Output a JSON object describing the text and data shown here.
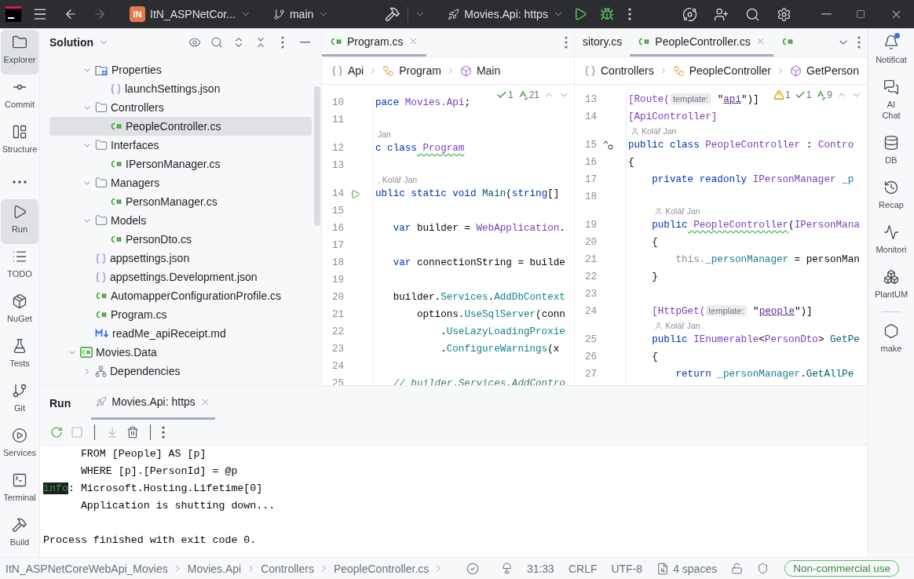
{
  "title_bar": {
    "back": {
      "disabled": false
    },
    "forward": {
      "disabled": true
    },
    "project": {
      "badge": "IN",
      "label": "ItN_ASPNetCor..."
    },
    "branch": "main",
    "run_config": "Movies.Api: https"
  },
  "left_toolbar": [
    {
      "label": "Explorer",
      "selected": true
    },
    {
      "label": "Commit",
      "selected": false
    },
    {
      "label": "Structure",
      "selected": false
    },
    {
      "selected": false
    },
    {
      "label": "Run",
      "selected": true
    },
    {
      "label": "TODO",
      "selected": false
    },
    {
      "label": "NuGet",
      "selected": false
    },
    {
      "label": "Tests",
      "selected": false
    },
    {
      "label": "Git",
      "selected": false
    },
    {
      "label": "Services",
      "selected": false
    },
    {
      "label": "Terminal",
      "selected": false
    },
    {
      "label": "Build",
      "selected": false
    }
  ],
  "project_panel": {
    "title": "Solution",
    "tree": [
      {
        "children": [
          {
            "label": "Properties",
            "kind": "properties",
            "expanded": true,
            "selected": false,
            "children": [
              {
                "label": "launchSettings.json",
                "kind": "json",
                "selected": false
              }
            ]
          },
          {
            "label": "Controllers",
            "kind": "folder",
            "expanded": true,
            "selected": false,
            "children": [
              {
                "label": "PeopleController.cs",
                "kind": "csharp",
                "selected": true
              }
            ]
          },
          {
            "label": "Interfaces",
            "kind": "folder",
            "expanded": true,
            "selected": false,
            "children": [
              {
                "label": "IPersonManager.cs",
                "kind": "csharp",
                "selected": false
              }
            ]
          },
          {
            "label": "Managers",
            "kind": "folder",
            "expanded": true,
            "selected": false,
            "children": [
              {
                "label": "PersonManager.cs",
                "kind": "csharp",
                "selected": false
              }
            ]
          },
          {
            "label": "Models",
            "kind": "folder",
            "expanded": true,
            "selected": false,
            "children": [
              {
                "label": "PersonDto.cs",
                "kind": "csharp",
                "selected": false
              }
            ]
          },
          {
            "label": "appsettings.json",
            "kind": "json",
            "selected": false
          },
          {
            "label": "appsettings.Development.json",
            "kind": "json",
            "selected": false
          },
          {
            "label": "AutomapperConfigurationProfile.cs",
            "kind": "csharp",
            "selected": false
          },
          {
            "label": "Program.cs",
            "kind": "csharp",
            "selected": false
          },
          {
            "label": "readMe_apiReceipt.md",
            "kind": "markdown",
            "selected": false
          }
        ]
      },
      {
        "label": "Movies.Data",
        "kind": "project",
        "expanded": true,
        "selected": false,
        "children": [
          {
            "label": "Dependencies",
            "kind": "dependencies",
            "expanded": false,
            "selected": false
          }
        ]
      }
    ]
  },
  "editors": [
    {
      "tabs": [
        {
          "label": "Program.cs",
          "kind": "csharp",
          "selected": true
        }
      ],
      "breadcrumb": [
        {
          "kind": "namespace",
          "label": "Api"
        },
        {
          "kind": "class",
          "label": "Program"
        },
        {
          "kind": "method",
          "label": "Main"
        }
      ],
      "inspections": [
        {
          "kind": "ok",
          "count": "1"
        },
        {
          "kind": "typo",
          "count": "21"
        }
      ],
      "lines": [
        {
          "kind": "code",
          "number": "10",
          "segments": [
            {
              "kind": "keyword",
              "text": "pace"
            },
            {
              "kind": "type",
              "text": " Movies.Api"
            },
            {
              "kind": "plain",
              "text": ";"
            }
          ]
        },
        {
          "kind": "code",
          "number": "11"
        },
        {
          "kind": "author",
          "text": "Jan",
          "avatar": false
        },
        {
          "kind": "code",
          "number": "12",
          "segments": [
            {
              "kind": "keyword",
              "text": "c class"
            },
            {
              "kind": "type-typo",
              "text": " Program"
            }
          ]
        },
        {
          "kind": "code",
          "number": "13"
        },
        {
          "kind": "author",
          "text": ", Kolář Jan",
          "avatar": false
        },
        {
          "kind": "code",
          "number": "14",
          "gutter": {
            "kind": "run"
          },
          "segments": [
            {
              "kind": "keyword",
              "text": "ublic static void"
            },
            {
              "kind": "method",
              "text": " Main"
            },
            {
              "kind": "plain",
              "text": "("
            },
            {
              "kind": "keyword",
              "text": "string"
            },
            {
              "kind": "plain",
              "text": "[]"
            }
          ]
        },
        {
          "kind": "code",
          "number": "15"
        },
        {
          "kind": "code",
          "number": "16",
          "segments": [
            {
              "kind": "keyword",
              "text": "   var"
            },
            {
              "kind": "plain",
              "text": " builder = "
            },
            {
              "kind": "type",
              "text": "WebApplication"
            },
            {
              "kind": "plain",
              "text": "."
            }
          ]
        },
        {
          "kind": "code",
          "number": "17"
        },
        {
          "kind": "code",
          "number": "18",
          "segments": [
            {
              "kind": "keyword",
              "text": "   var"
            },
            {
              "kind": "plain",
              "text": " connectionString = builde"
            }
          ]
        },
        {
          "kind": "code",
          "number": "19"
        },
        {
          "kind": "code",
          "number": "20",
          "segments": [
            {
              "kind": "plain",
              "text": "   builder."
            },
            {
              "kind": "member",
              "text": "Services"
            },
            {
              "kind": "plain",
              "text": "."
            },
            {
              "kind": "member",
              "text": "AddDbContext"
            }
          ]
        },
        {
          "kind": "code",
          "number": "21",
          "segments": [
            {
              "kind": "plain",
              "text": "       options."
            },
            {
              "kind": "member",
              "text": "UseSqlServer"
            },
            {
              "kind": "plain",
              "text": "(conn"
            }
          ]
        },
        {
          "kind": "code",
          "number": "22",
          "segments": [
            {
              "kind": "plain",
              "text": "           ."
            },
            {
              "kind": "member",
              "text": "UseLazyLoadingProxie"
            }
          ]
        },
        {
          "kind": "code",
          "number": "23",
          "segments": [
            {
              "kind": "plain",
              "text": "           ."
            },
            {
              "kind": "member",
              "text": "ConfigureWarnings"
            },
            {
              "kind": "plain",
              "text": "(x"
            }
          ]
        },
        {
          "kind": "code",
          "number": "24"
        },
        {
          "kind": "code",
          "number": "25",
          "segments": [
            {
              "kind": "comment",
              "text": "   // builder.Services.AddContro"
            }
          ]
        }
      ]
    },
    {
      "tabs": [
        {
          "label": "sitory.cs",
          "kind": "plain",
          "selected": false
        },
        {
          "label": "PeopleController.cs",
          "kind": "csharp",
          "selected": true
        },
        {
          "kind": "csharp",
          "selected": false
        }
      ],
      "breadcrumb": [
        {
          "kind": "namespace",
          "label": "Controllers"
        },
        {
          "kind": "class",
          "label": "PeopleController"
        },
        {
          "kind": "method",
          "label": "GetPerson"
        }
      ],
      "inspections": [
        {
          "kind": "warning",
          "count": "1"
        },
        {
          "kind": "ok",
          "count": "1"
        },
        {
          "kind": "typo",
          "count": "9"
        }
      ],
      "lines": [
        {
          "kind": "code",
          "number": "13",
          "segments": [
            {
              "kind": "attribute",
              "text": "[Route("
            },
            {
              "kind": "hint",
              "text": "template:"
            },
            {
              "kind": "plain",
              "text": " \""
            },
            {
              "kind": "string",
              "text": "api"
            },
            {
              "kind": "plain",
              "text": "\")]"
            }
          ]
        },
        {
          "kind": "code",
          "number": "14",
          "segments": [
            {
              "kind": "attribute",
              "text": "[ApiController]"
            }
          ]
        },
        {
          "kind": "author",
          "text": "Kolář Jan",
          "avatar": true
        },
        {
          "kind": "code",
          "number": "15",
          "gutter": {
            "kind": "implements"
          },
          "segments": [
            {
              "kind": "keyword",
              "text": "public class"
            },
            {
              "kind": "type",
              "text": " PeopleController"
            },
            {
              "kind": "plain",
              "text": " : "
            },
            {
              "kind": "type",
              "text": "Contro"
            }
          ]
        },
        {
          "kind": "code",
          "number": "16",
          "segments": [
            {
              "kind": "plain",
              "text": "{"
            }
          ]
        },
        {
          "kind": "code",
          "number": "17",
          "segments": [
            {
              "kind": "keyword",
              "text": "    private readonly"
            },
            {
              "kind": "type",
              "text": " IPersonManager"
            },
            {
              "kind": "member",
              "text": " _p"
            }
          ]
        },
        {
          "kind": "code",
          "number": "18"
        },
        {
          "kind": "author",
          "text": "Kolář Jan",
          "avatar": true
        },
        {
          "kind": "code",
          "number": "19",
          "segments": [
            {
              "kind": "keyword",
              "text": "    public"
            },
            {
              "kind": "type-typo",
              "text": " PeopleController"
            },
            {
              "kind": "plain",
              "text": "("
            },
            {
              "kind": "type",
              "text": "IPersonMana"
            }
          ]
        },
        {
          "kind": "code",
          "number": "20",
          "segments": [
            {
              "kind": "plain",
              "text": "    {"
            }
          ]
        },
        {
          "kind": "code",
          "number": "21",
          "segments": [
            {
              "kind": "muted",
              "text": "        this."
            },
            {
              "kind": "member",
              "text": "_personManager"
            },
            {
              "kind": "plain",
              "text": " = personMan"
            }
          ]
        },
        {
          "kind": "code",
          "number": "22",
          "segments": [
            {
              "kind": "plain",
              "text": "    }"
            }
          ]
        },
        {
          "kind": "code",
          "number": "23"
        },
        {
          "kind": "code",
          "number": "24",
          "segments": [
            {
              "kind": "attribute",
              "text": "    [HttpGet("
            },
            {
              "kind": "hint",
              "text": "template:"
            },
            {
              "kind": "plain",
              "text": " \""
            },
            {
              "kind": "string",
              "text": "people"
            },
            {
              "kind": "plain",
              "text": "\")]"
            }
          ]
        },
        {
          "kind": "author",
          "text": "Kolář Jan",
          "avatar": true
        },
        {
          "kind": "code",
          "number": "25",
          "segments": [
            {
              "kind": "keyword",
              "text": "    public"
            },
            {
              "kind": "type",
              "text": " IEnumerable"
            },
            {
              "kind": "plain",
              "text": "<"
            },
            {
              "kind": "type",
              "text": "PersonDto"
            },
            {
              "kind": "plain",
              "text": "> "
            },
            {
              "kind": "method",
              "text": "GetPe"
            }
          ]
        },
        {
          "kind": "code",
          "number": "26",
          "segments": [
            {
              "kind": "plain",
              "text": "    {"
            }
          ]
        },
        {
          "kind": "code",
          "number": "27",
          "segments": [
            {
              "kind": "keyword",
              "text": "        return"
            },
            {
              "kind": "member",
              "text": " _personManager"
            },
            {
              "kind": "plain",
              "text": "."
            },
            {
              "kind": "method",
              "text": "GetAllPe"
            }
          ]
        }
      ]
    }
  ],
  "right_toolbar": [
    {
      "label": "Notificat",
      "unread": true
    },
    {
      "label": "AI Chat",
      "unread": false
    },
    {
      "label": "DB",
      "unread": false
    },
    {
      "label": "Recap",
      "unread": false
    },
    {
      "label": "Monitori",
      "unread": false
    },
    {
      "label": "PlantUM",
      "unread": false
    },
    {
      "label": "make",
      "unread": false
    }
  ],
  "run_panel": {
    "title": "Run",
    "tabs": [
      {
        "label": "Movies.Api: https",
        "selected": true
      }
    ],
    "tools": [
      {
        "disabled": false
      },
      {
        "disabled": true
      },
      {
        "disabled": true
      },
      {
        "disabled": false
      },
      {
        "disabled": false
      }
    ],
    "console": [
      {
        "kind": "log",
        "text": "      FROM [People] AS [p]"
      },
      {
        "kind": "log",
        "text": "      WHERE [p].[PersonId] = @p"
      },
      {
        "kind": "tagged",
        "tag": "info",
        "text": ": Microsoft.Hosting.Lifetime[0]"
      },
      {
        "kind": "log",
        "text": "      Application is shutting down..."
      },
      {
        "kind": "blank"
      },
      {
        "kind": "log",
        "text": "Process finished with exit code 0."
      }
    ]
  },
  "status_bar": {
    "path": [
      "ItN_ASPNetCoreWebApi_Movies",
      "Movies.Api",
      "Controllers",
      "PeopleController.cs"
    ],
    "caret": "31:33",
    "line_ending": "CRLF",
    "encoding": "UTF-8",
    "indent": "4 spaces",
    "license": "Non-commercial use"
  }
}
